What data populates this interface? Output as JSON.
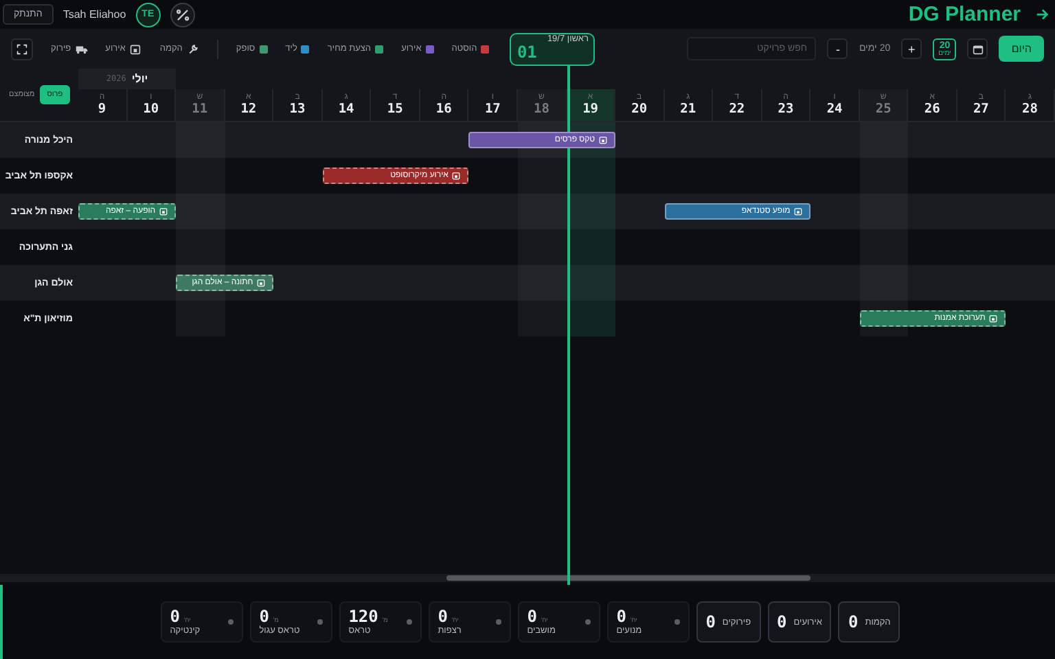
{
  "header": {
    "title": "DG Planner",
    "user": "Tsah Eliahoo",
    "initials": "TE",
    "logout": "התנתק"
  },
  "toolbar": {
    "today_button": "היום",
    "range_box": {
      "value": "20",
      "unit": "ימים"
    },
    "plus": "+",
    "range_label": "20 ימים",
    "minus": "-",
    "search": {
      "placeholder": "חפש פרויקט"
    },
    "today_card": {
      "date": "ראשון 19/7",
      "count": "01"
    },
    "legend": [
      {
        "label": "הוסטה",
        "color": "#c53a3a"
      },
      {
        "label": "אירוע",
        "color": "#7a5cc7"
      },
      {
        "label": "הצעת מחיר",
        "color": "#2e9e6e"
      },
      {
        "label": "ליד",
        "color": "#2f8cc4"
      },
      {
        "label": "סופק",
        "color": "#3d9970"
      }
    ],
    "phases": [
      {
        "label": "הקמה",
        "kind": "setup"
      },
      {
        "label": "אירוע",
        "kind": "event"
      },
      {
        "label": "פירוק",
        "kind": "teardown"
      }
    ]
  },
  "view_toggle": [
    {
      "label": "פרוס",
      "selected": true
    },
    {
      "label": "מצומצם",
      "selected": false
    }
  ],
  "month": {
    "name": "יולי",
    "year": "2026"
  },
  "days": [
    {
      "weekday": "ג",
      "day": "28",
      "kind": "weekday"
    },
    {
      "weekday": "ב",
      "day": "27",
      "kind": "weekday"
    },
    {
      "weekday": "א",
      "day": "26",
      "kind": "weekday"
    },
    {
      "weekday": "ש",
      "day": "25",
      "kind": "saturday"
    },
    {
      "weekday": "ו",
      "day": "24",
      "kind": "weekday"
    },
    {
      "weekday": "ה",
      "day": "23",
      "kind": "weekday"
    },
    {
      "weekday": "ד",
      "day": "22",
      "kind": "weekday"
    },
    {
      "weekday": "ג",
      "day": "21",
      "kind": "weekday"
    },
    {
      "weekday": "ב",
      "day": "20",
      "kind": "weekday"
    },
    {
      "weekday": "א",
      "day": "19",
      "kind": "today"
    },
    {
      "weekday": "ש",
      "day": "18",
      "kind": "saturday"
    },
    {
      "weekday": "ו",
      "day": "17",
      "kind": "weekday"
    },
    {
      "weekday": "ה",
      "day": "16",
      "kind": "weekday"
    },
    {
      "weekday": "ד",
      "day": "15",
      "kind": "weekday"
    },
    {
      "weekday": "ג",
      "day": "14",
      "kind": "weekday"
    },
    {
      "weekday": "ב",
      "day": "13",
      "kind": "weekday"
    },
    {
      "weekday": "א",
      "day": "12",
      "kind": "weekday"
    },
    {
      "weekday": "ש",
      "day": "11",
      "kind": "saturday"
    },
    {
      "weekday": "ו",
      "day": "10",
      "kind": "weekday"
    },
    {
      "weekday": "ה",
      "day": "9",
      "kind": "weekday"
    }
  ],
  "venues": [
    {
      "name": "היכל מנורה",
      "events": [
        {
          "title": "טקס פרסים",
          "color": "#6a55a6",
          "dashed": false
        }
      ]
    },
    {
      "name": "אקספו תל אביב",
      "events": [
        {
          "title": "אירוע מיקרוסופט",
          "color": "#9a2a2a",
          "dashed": true
        }
      ]
    },
    {
      "name": "זאפה תל אביב",
      "events": [
        {
          "title": "מופע סטנדאפ",
          "color": "#2b6f9c",
          "dashed": false
        },
        {
          "title": "הופעה – זאפה",
          "color": "#2a7d5c",
          "dashed": true
        }
      ]
    },
    {
      "name": "גני התערוכה"
    },
    {
      "name": "אולם הגן",
      "events": [
        {
          "title": "חתונה – אולם הגן",
          "color": "#3e7a62",
          "dashed": true
        }
      ]
    },
    {
      "name": "מוזיאון ת\"א",
      "events": [
        {
          "title": "תערוכת אמנות",
          "color": "#2a7d5c",
          "dashed": true
        }
      ]
    }
  ],
  "stats": [
    {
      "value": "0",
      "label": "הקמות",
      "kind": "total"
    },
    {
      "value": "0",
      "label": "אירועים",
      "kind": "total"
    },
    {
      "value": "0",
      "label": "פירוקים",
      "kind": "total"
    },
    {
      "value": "0",
      "unit": "יח'",
      "label": "מנועים",
      "kind": "resource"
    },
    {
      "value": "0",
      "unit": "יח'",
      "label": "מושבים",
      "kind": "resource"
    },
    {
      "value": "0",
      "unit": "יח'",
      "label": "רצפות",
      "kind": "resource"
    },
    {
      "value": "120",
      "unit": "מ'",
      "label": "טראס",
      "kind": "resource"
    },
    {
      "value": "0",
      "unit": "מ'",
      "label": "טראס עגול",
      "kind": "resource"
    },
    {
      "value": "0",
      "unit": "יח'",
      "label": "קינטיקה",
      "kind": "resource"
    }
  ]
}
